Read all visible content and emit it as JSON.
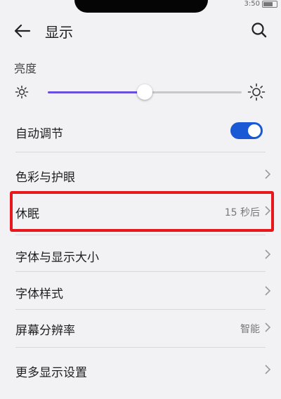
{
  "status_bar": {
    "time": "3:50"
  },
  "header": {
    "title": "显示"
  },
  "brightness": {
    "section_label": "亮度",
    "level": 0.5
  },
  "rows": [
    {
      "label": "自动调节",
      "value": "",
      "toggle": true
    },
    {
      "label": "色彩与护眼",
      "value": ""
    },
    {
      "label": "休眠",
      "value": "15 秒后"
    },
    {
      "label": "字体与显示大小",
      "value": ""
    },
    {
      "label": "字体样式",
      "value": ""
    },
    {
      "label": "屏幕分辨率",
      "value": "智能"
    },
    {
      "label": "更多显示设置",
      "value": ""
    }
  ],
  "colors": {
    "accent": "#1a59d6",
    "slider_fill": "#6b4de0",
    "highlight": "#e8171c",
    "background": "#f2f1f4"
  },
  "icons": [
    "back-arrow-icon",
    "search-icon",
    "brightness-low-icon",
    "brightness-high-icon",
    "chevron-right-icon"
  ]
}
